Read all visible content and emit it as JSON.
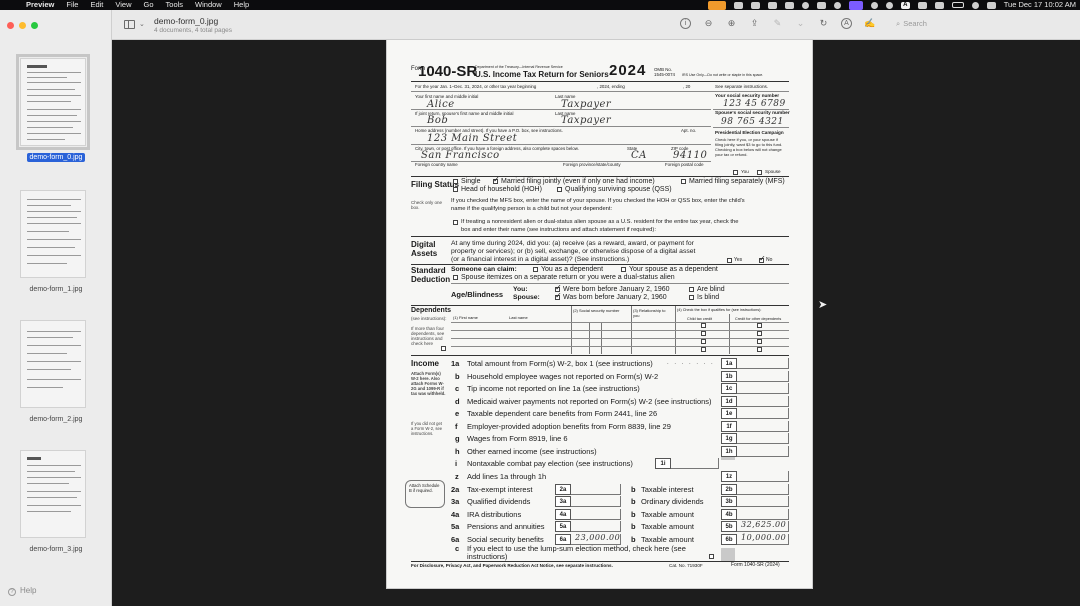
{
  "menubar": {
    "app": "Preview",
    "menus": [
      "File",
      "Edit",
      "View",
      "Go",
      "Tools",
      "Window",
      "Help"
    ],
    "clock": "Tue Dec 17  10:02 AM"
  },
  "window": {
    "title": "demo-form_0.jpg",
    "subtitle": "4 documents, 4 total pages",
    "search_placeholder": "Search"
  },
  "sidebar": {
    "thumbnails": [
      {
        "label": "demo-form_0.jpg",
        "selected": true
      },
      {
        "label": "demo-form_1.jpg",
        "selected": false
      },
      {
        "label": "demo-form_2.jpg",
        "selected": false
      },
      {
        "label": "demo-form_3.jpg",
        "selected": false
      }
    ],
    "help": "Help"
  },
  "form": {
    "form_number": "1040-SR",
    "dept": "Department of the Treasury—Internal Revenue Service",
    "title": "U.S. Income Tax Return for Seniors",
    "year": "2024",
    "omb": "OMB No. 1545-0074",
    "irs_only": "IRS Use Only—Do not write or staple in this space.",
    "tax_year_line": "For the year Jan. 1–Dec. 31, 2024, or other tax year beginning",
    "tax_year_mid": ", 2024, ending",
    "tax_year_end": ", 20",
    "see_instructions": "See separate instructions.",
    "labels": {
      "first_name": "Your first name and middle initial",
      "last_name": "Last name",
      "ssn": "Your social security number",
      "spouse_first": "If joint return, spouse's first name and middle initial",
      "spouse_last": "Last name",
      "spouse_ssn": "Spouse's social security number",
      "address": "Home address (number and street). If you have a P.O. box, see instructions.",
      "apt": "Apt. no.",
      "pec_title": "Presidential Election Campaign",
      "pec_text": "Check here if you, or your spouse if filing jointly, want $3 to go to this fund. Checking a box below will not change your tax or refund.",
      "pec_you": "You",
      "pec_spouse": "Spouse",
      "city": "City, town, or post office. If you have a foreign address, also complete spaces below.",
      "state": "State",
      "zip": "ZIP code",
      "foreign_country": "Foreign country name",
      "foreign_province": "Foreign province/state/county",
      "foreign_postal": "Foreign postal code"
    },
    "values": {
      "first_name": "Alice",
      "last_name": "Taxpayer",
      "ssn": "123 45 6789",
      "spouse_first": "Bob",
      "spouse_last": "Taxpayer",
      "spouse_ssn": "98 765 4321",
      "address": "123 Main Street",
      "city": "San Francisco",
      "state": "CA",
      "zip": "94110"
    },
    "filing_status": {
      "title": "Filing Status",
      "sub": "Check only one box.",
      "single": "Single",
      "mfj": "Married filing jointly (even if only one had income)",
      "mfs": "Married filing separately (MFS)",
      "hoh": "Head of household (HOH)",
      "qss": "Qualifying surviving spouse (QSS)",
      "mfs_note_1": "If you checked the MFS box, enter the name of your spouse. If you checked the HOH or QSS box, enter the child's",
      "mfs_note_2": "name if the qualifying person is a child but not your dependent:",
      "nra_note_1": "If treating a nonresident alien or dual-status alien spouse as a U.S. resident for the entire tax year, check the",
      "nra_note_2": "box and enter their name (see instructions and attach statement if required):"
    },
    "digital_assets": {
      "title": "Digital Assets",
      "q1": "At any time during 2024, did you: (a) receive (as a reward, award, or payment for",
      "q2": "property or services); or (b) sell, exchange, or otherwise dispose of a digital asset",
      "q3": "(or a financial interest in a digital asset)? (See instructions.)",
      "yes": "Yes",
      "no": "No"
    },
    "standard_deduction": {
      "title": "Standard Deduction",
      "claim": "Someone can claim:",
      "you_dep": "You as a dependent",
      "spouse_dep": "Your spouse as a dependent",
      "itemize": "Spouse itemizes on a separate return or you were a dual-status alien"
    },
    "age_blind": {
      "title": "Age/Blindness",
      "you": "You:",
      "spouse": "Spouse:",
      "born_you": "Were born before January 2, 1960",
      "born_spouse": "Was born before January 2, 1960",
      "blind_you": "Are blind",
      "blind_spouse": "Is blind"
    },
    "dependents": {
      "title": "Dependents",
      "sub": "(see instructions):",
      "more": "If more than four dependents, see instructions and check here",
      "col1": "(1) First name",
      "col1b": "Last name",
      "col2": "(2) Social security number",
      "col3": "(3) Relationship to you",
      "col4": "(4) Check the box if qualifies for (see instructions):",
      "col4a": "Child tax credit",
      "col4b": "Credit for other dependents"
    },
    "income": {
      "title": "Income",
      "sub1": "Attach Form(s) W-2 here. Also attach Forms W-2G and 1099-R if tax was withheld.",
      "sub2": "If you did not get a Form W-2, see instructions.",
      "lines": [
        {
          "num": "1a",
          "text": "Total amount from Form(s) W-2, box 1 (see instructions)"
        },
        {
          "num": "b",
          "box": "1b",
          "text": "Household employee wages not reported on Form(s) W-2"
        },
        {
          "num": "c",
          "box": "1c",
          "text": "Tip income not reported on line 1a (see instructions)"
        },
        {
          "num": "d",
          "box": "1d",
          "text": "Medicaid waiver payments not reported on Form(s) W-2 (see instructions)"
        },
        {
          "num": "e",
          "box": "1e",
          "text": "Taxable dependent care benefits from Form 2441, line 26"
        },
        {
          "num": "f",
          "box": "1f",
          "text": "Employer-provided adoption benefits from Form 8839, line 29"
        },
        {
          "num": "g",
          "box": "1g",
          "text": "Wages from Form 8919, line 6"
        },
        {
          "num": "h",
          "box": "1h",
          "text": "Other earned income (see instructions)"
        },
        {
          "num": "i",
          "box": "1i",
          "text": "Nontaxable combat pay election (see instructions)"
        },
        {
          "num": "z",
          "box": "1z",
          "text": "Add lines 1a through 1h"
        }
      ],
      "schedule_b": "Attach Schedule B if required.",
      "left_lines": [
        {
          "num": "2a",
          "text": "Tax-exempt interest",
          "value": ""
        },
        {
          "num": "3a",
          "text": "Qualified dividends",
          "value": ""
        },
        {
          "num": "4a",
          "text": "IRA distributions",
          "value": ""
        },
        {
          "num": "5a",
          "text": "Pensions and annuities",
          "value": ""
        },
        {
          "num": "6a",
          "text": "Social security benefits",
          "value": "23,000.00"
        }
      ],
      "right_lines": [
        {
          "letter": "b",
          "text": "Taxable interest",
          "box": "2b",
          "value": ""
        },
        {
          "letter": "b",
          "text": "Ordinary dividends",
          "box": "3b",
          "value": ""
        },
        {
          "letter": "b",
          "text": "Taxable amount",
          "box": "4b",
          "value": ""
        },
        {
          "letter": "b",
          "text": "Taxable amount",
          "box": "5b",
          "value": "32,625.00"
        },
        {
          "letter": "b",
          "text": "Taxable amount",
          "box": "6b",
          "value": "10,000.00"
        }
      ],
      "line6c_1": "If you elect to use the lump-sum election method, check here (see",
      "line6c_2": "instructions)"
    },
    "footer": {
      "notice": "For Disclosure, Privacy Act, and Paperwork Reduction Act Notice, see separate instructions.",
      "cat": "Cat. No. 71930F",
      "form": "Form 1040-SR (2024)"
    }
  },
  "colors": {
    "selection": "#2a62d8",
    "menubar": "#0c0c0e",
    "sidebar": "#ececec",
    "canvas": "#1d1d1d"
  }
}
